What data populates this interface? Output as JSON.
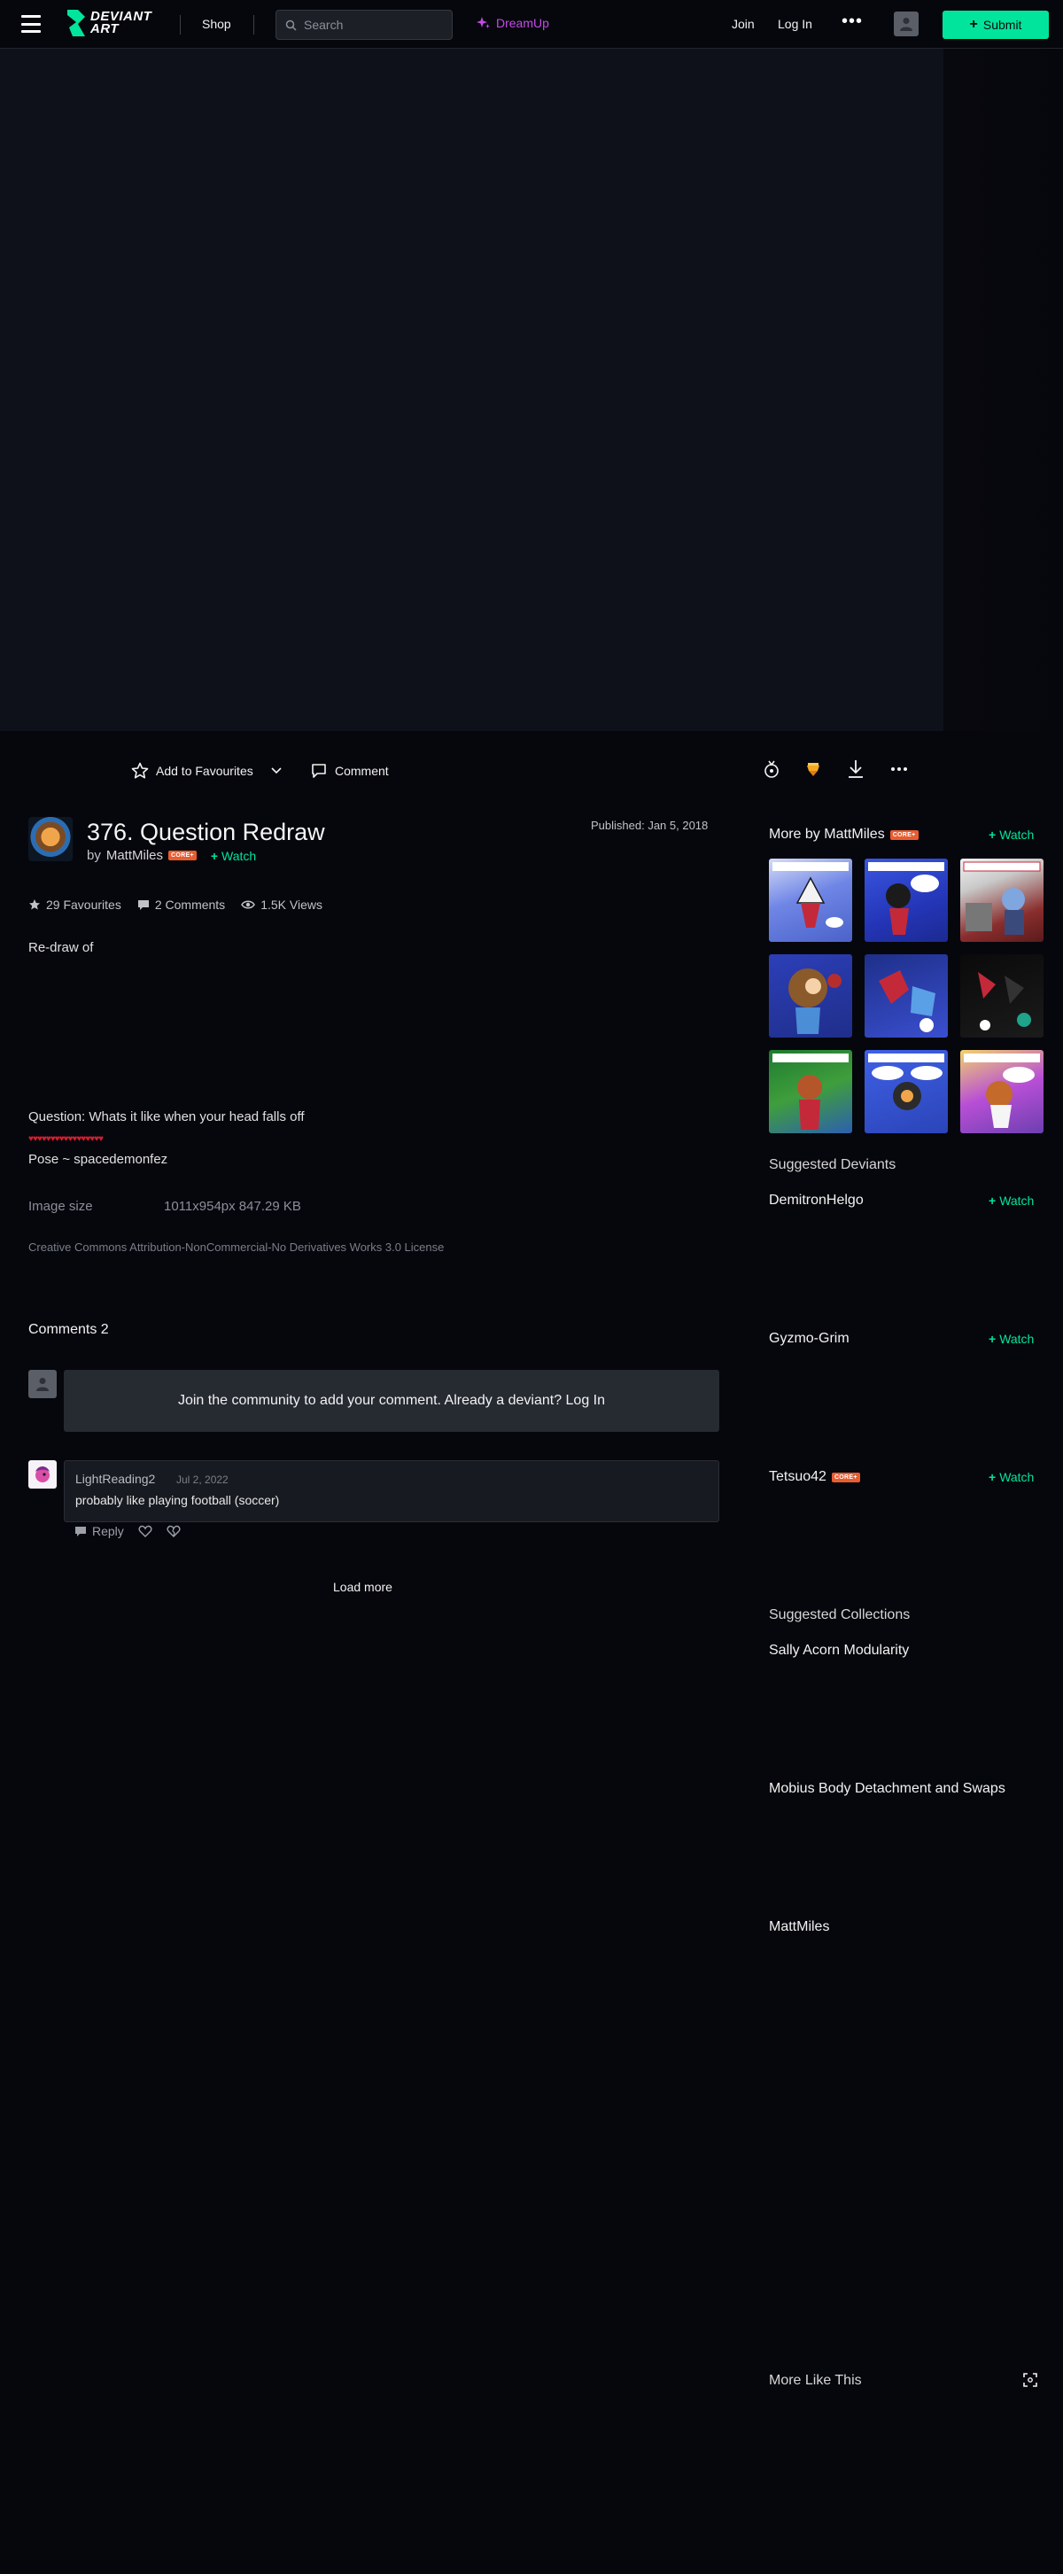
{
  "header": {
    "shop": "Shop",
    "search_placeholder": "Search",
    "dreamup": "DreamUp",
    "join": "Join",
    "login": "Log In",
    "more": "•••",
    "submit": "Submit",
    "logo_line1": "DEVIANT",
    "logo_line2": "ART",
    "accent": "#00e59b",
    "dreamup_color": "#c64ae8"
  },
  "actions": {
    "add_favourites": "Add to Favourites",
    "comment": "Comment"
  },
  "deviation": {
    "title": "376. Question Redraw",
    "by": "by",
    "author": "MattMiles",
    "core_badge": "CORE+",
    "watch": "Watch",
    "published": "Published: Jan 5, 2018",
    "favourites": "29 Favourites",
    "comments_count": "2 Comments",
    "views": "1.5K Views",
    "description_line1": "Re-draw of",
    "description_line2": "Question: Whats it like when your head falls off",
    "hearts": "♥♥♥♥♥♥♥♥♥♥♥♥♥♥♥♥♥",
    "description_line3": "Pose ~ spacedemonfez",
    "image_size_label": "Image size",
    "image_size_value": "1011x954px 847.29 KB",
    "license": "Creative Commons Attribution-NonCommercial-No Derivatives Works 3.0 License"
  },
  "comments": {
    "heading": "Comments 2",
    "join_prompt": "Join the community to add your comment. Already a deviant? Log In",
    "items": [
      {
        "user": "LightReading2",
        "date": "Jul 2, 2022",
        "text": "probably like playing football (soccer)",
        "reply": "Reply"
      }
    ],
    "load_more": "Load more"
  },
  "sidebar": {
    "more_by": "More by MattMiles",
    "core_badge": "CORE+",
    "watch": "Watch",
    "suggested_deviants_heading": "Suggested Deviants",
    "suggested_deviants": [
      {
        "name": "DemitronHelgo",
        "watch": "Watch",
        "core": false
      },
      {
        "name": "Gyzmo-Grim",
        "watch": "Watch",
        "core": false
      },
      {
        "name": "Tetsuo42",
        "watch": "Watch",
        "core": true,
        "badge": "CORE+"
      }
    ],
    "suggested_collections_heading": "Suggested Collections",
    "suggested_collections": [
      "Sally Acorn Modularity",
      "Mobius Body Detachment and Swaps",
      "MattMiles"
    ],
    "more_like_this": "More Like This"
  }
}
